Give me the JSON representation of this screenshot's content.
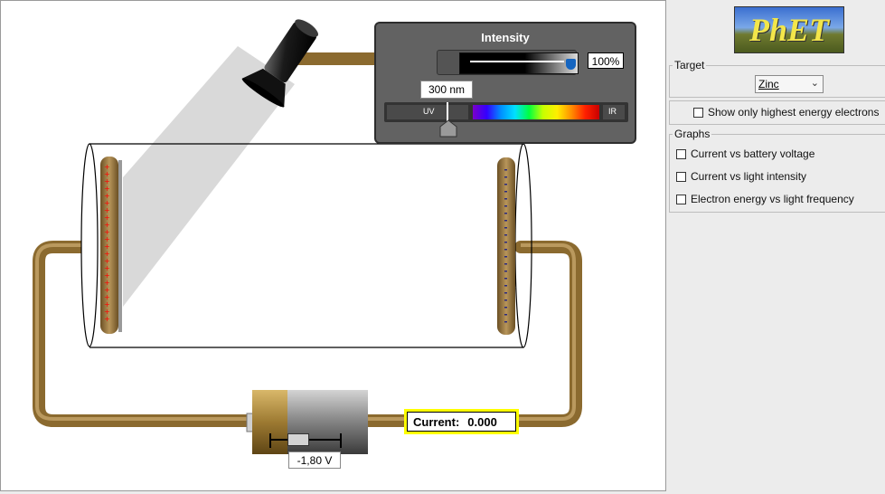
{
  "intensity_panel": {
    "title": "Intensity",
    "percent_label": "100%",
    "intensity_level": 1.0,
    "wavelength_label": "300 nm",
    "uv_label": "UV",
    "ir_label": "IR"
  },
  "current_display": {
    "label": "Current:",
    "value": "0.000"
  },
  "battery": {
    "voltage_label": "-1,80 V"
  },
  "control_panel": {
    "logo_text": "PhET",
    "target": {
      "legend": "Target",
      "selected": "Zinc"
    },
    "highest_energy_checkbox": {
      "label": "Show only highest energy electrons",
      "checked": false
    },
    "graphs": {
      "legend": "Graphs",
      "items": [
        {
          "label": "Current vs battery voltage",
          "checked": false
        },
        {
          "label": "Current vs light intensity",
          "checked": false
        },
        {
          "label": "Electron energy vs light frequency",
          "checked": false
        }
      ]
    }
  },
  "colors": {
    "wire": "#8b6a2f",
    "panel_bg": "#5f5f5f",
    "current_border": "#ffff00",
    "spectrum": [
      "#7a00c9",
      "#0000ff",
      "#00c8ff",
      "#00ff00",
      "#ffff00",
      "#ff7f00",
      "#ff0000"
    ]
  }
}
